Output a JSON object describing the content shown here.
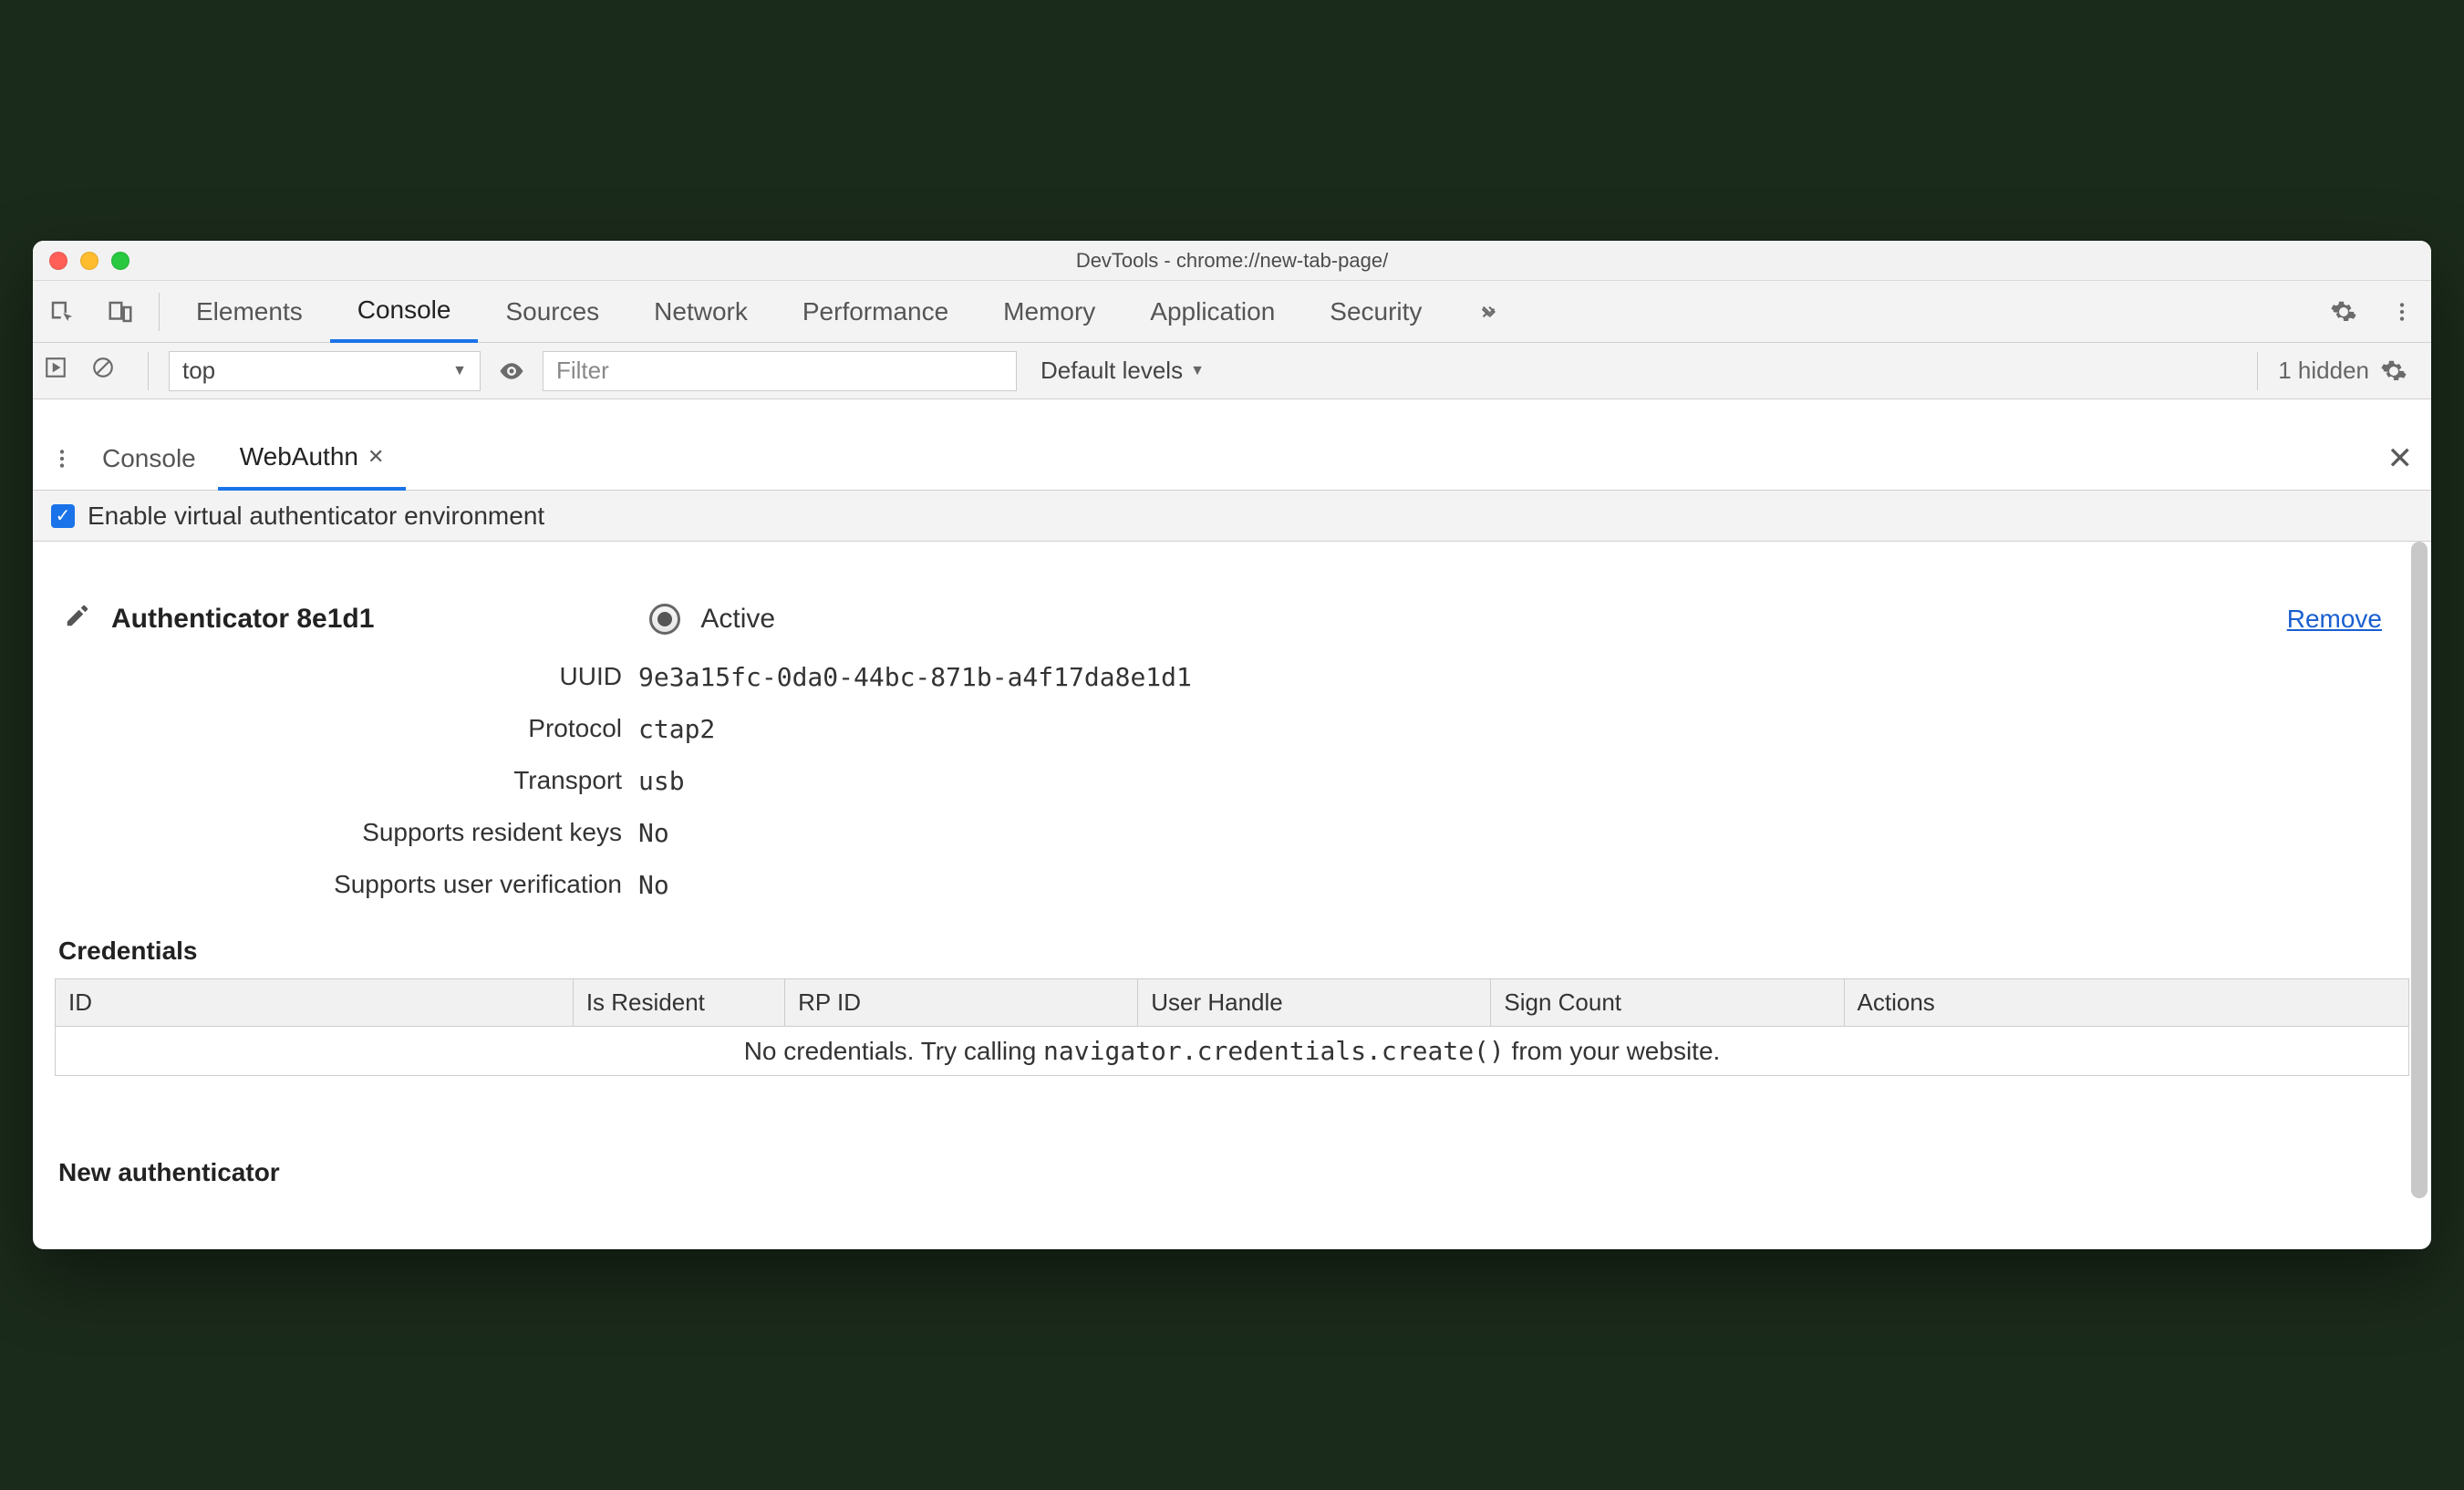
{
  "window": {
    "title": "DevTools - chrome://new-tab-page/"
  },
  "topTabs": {
    "items": [
      "Elements",
      "Console",
      "Sources",
      "Network",
      "Performance",
      "Memory",
      "Application",
      "Security"
    ],
    "activeIndex": 1
  },
  "consoleBar": {
    "contextSelector": "top",
    "filterPlaceholder": "Filter",
    "filterValue": "",
    "levelsLabel": "Default levels",
    "hiddenCount": "1 hidden"
  },
  "drawer": {
    "tabs": [
      {
        "label": "Console",
        "closable": false,
        "active": false
      },
      {
        "label": "WebAuthn",
        "closable": true,
        "active": true
      }
    ]
  },
  "webauthn": {
    "enableLabel": "Enable virtual authenticator environment",
    "enableChecked": true,
    "authenticator": {
      "title": "Authenticator 8e1d1",
      "activeLabel": "Active",
      "removeLabel": "Remove",
      "fields": {
        "uuidLabel": "UUID",
        "uuid": "9e3a15fc-0da0-44bc-871b-a4f17da8e1d1",
        "protocolLabel": "Protocol",
        "protocol": "ctap2",
        "transportLabel": "Transport",
        "transport": "usb",
        "residentLabel": "Supports resident keys",
        "resident": "No",
        "uvLabel": "Supports user verification",
        "uv": "No"
      }
    },
    "credentials": {
      "heading": "Credentials",
      "columns": [
        "ID",
        "Is Resident",
        "RP ID",
        "User Handle",
        "Sign Count",
        "Actions"
      ],
      "emptyPrefix": "No credentials. Try calling ",
      "emptyCode": "navigator.credentials.create()",
      "emptySuffix": " from your website."
    },
    "newAuth": {
      "heading": "New authenticator"
    }
  }
}
